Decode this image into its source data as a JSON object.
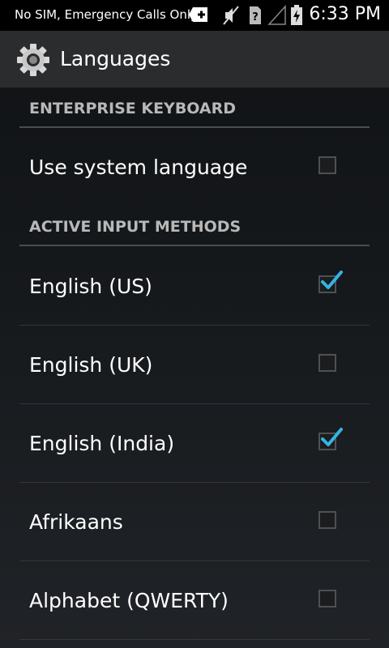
{
  "status_bar": {
    "carrier_text": "No SIM, Emergency Calls Only",
    "time": "6:33 PM",
    "icons": [
      "add-notification-icon",
      "muted-icon",
      "no-sim-icon",
      "signal-icon",
      "battery-charging-icon"
    ]
  },
  "action_bar": {
    "title": "Languages",
    "icon": "gear-icon"
  },
  "sections": [
    {
      "header": "ENTERPRISE KEYBOARD",
      "items": [
        {
          "label": "Use system language",
          "checked": false
        }
      ]
    },
    {
      "header": "ACTIVE INPUT METHODS",
      "items": [
        {
          "label": "English (US)",
          "checked": true
        },
        {
          "label": "English (UK)",
          "checked": false
        },
        {
          "label": "English (India)",
          "checked": true
        },
        {
          "label": "Afrikaans",
          "checked": false
        },
        {
          "label": "Alphabet (QWERTY)",
          "checked": false
        }
      ]
    }
  ],
  "colors": {
    "accent": "#33b5e5",
    "header_text": "#b8b8b8"
  }
}
